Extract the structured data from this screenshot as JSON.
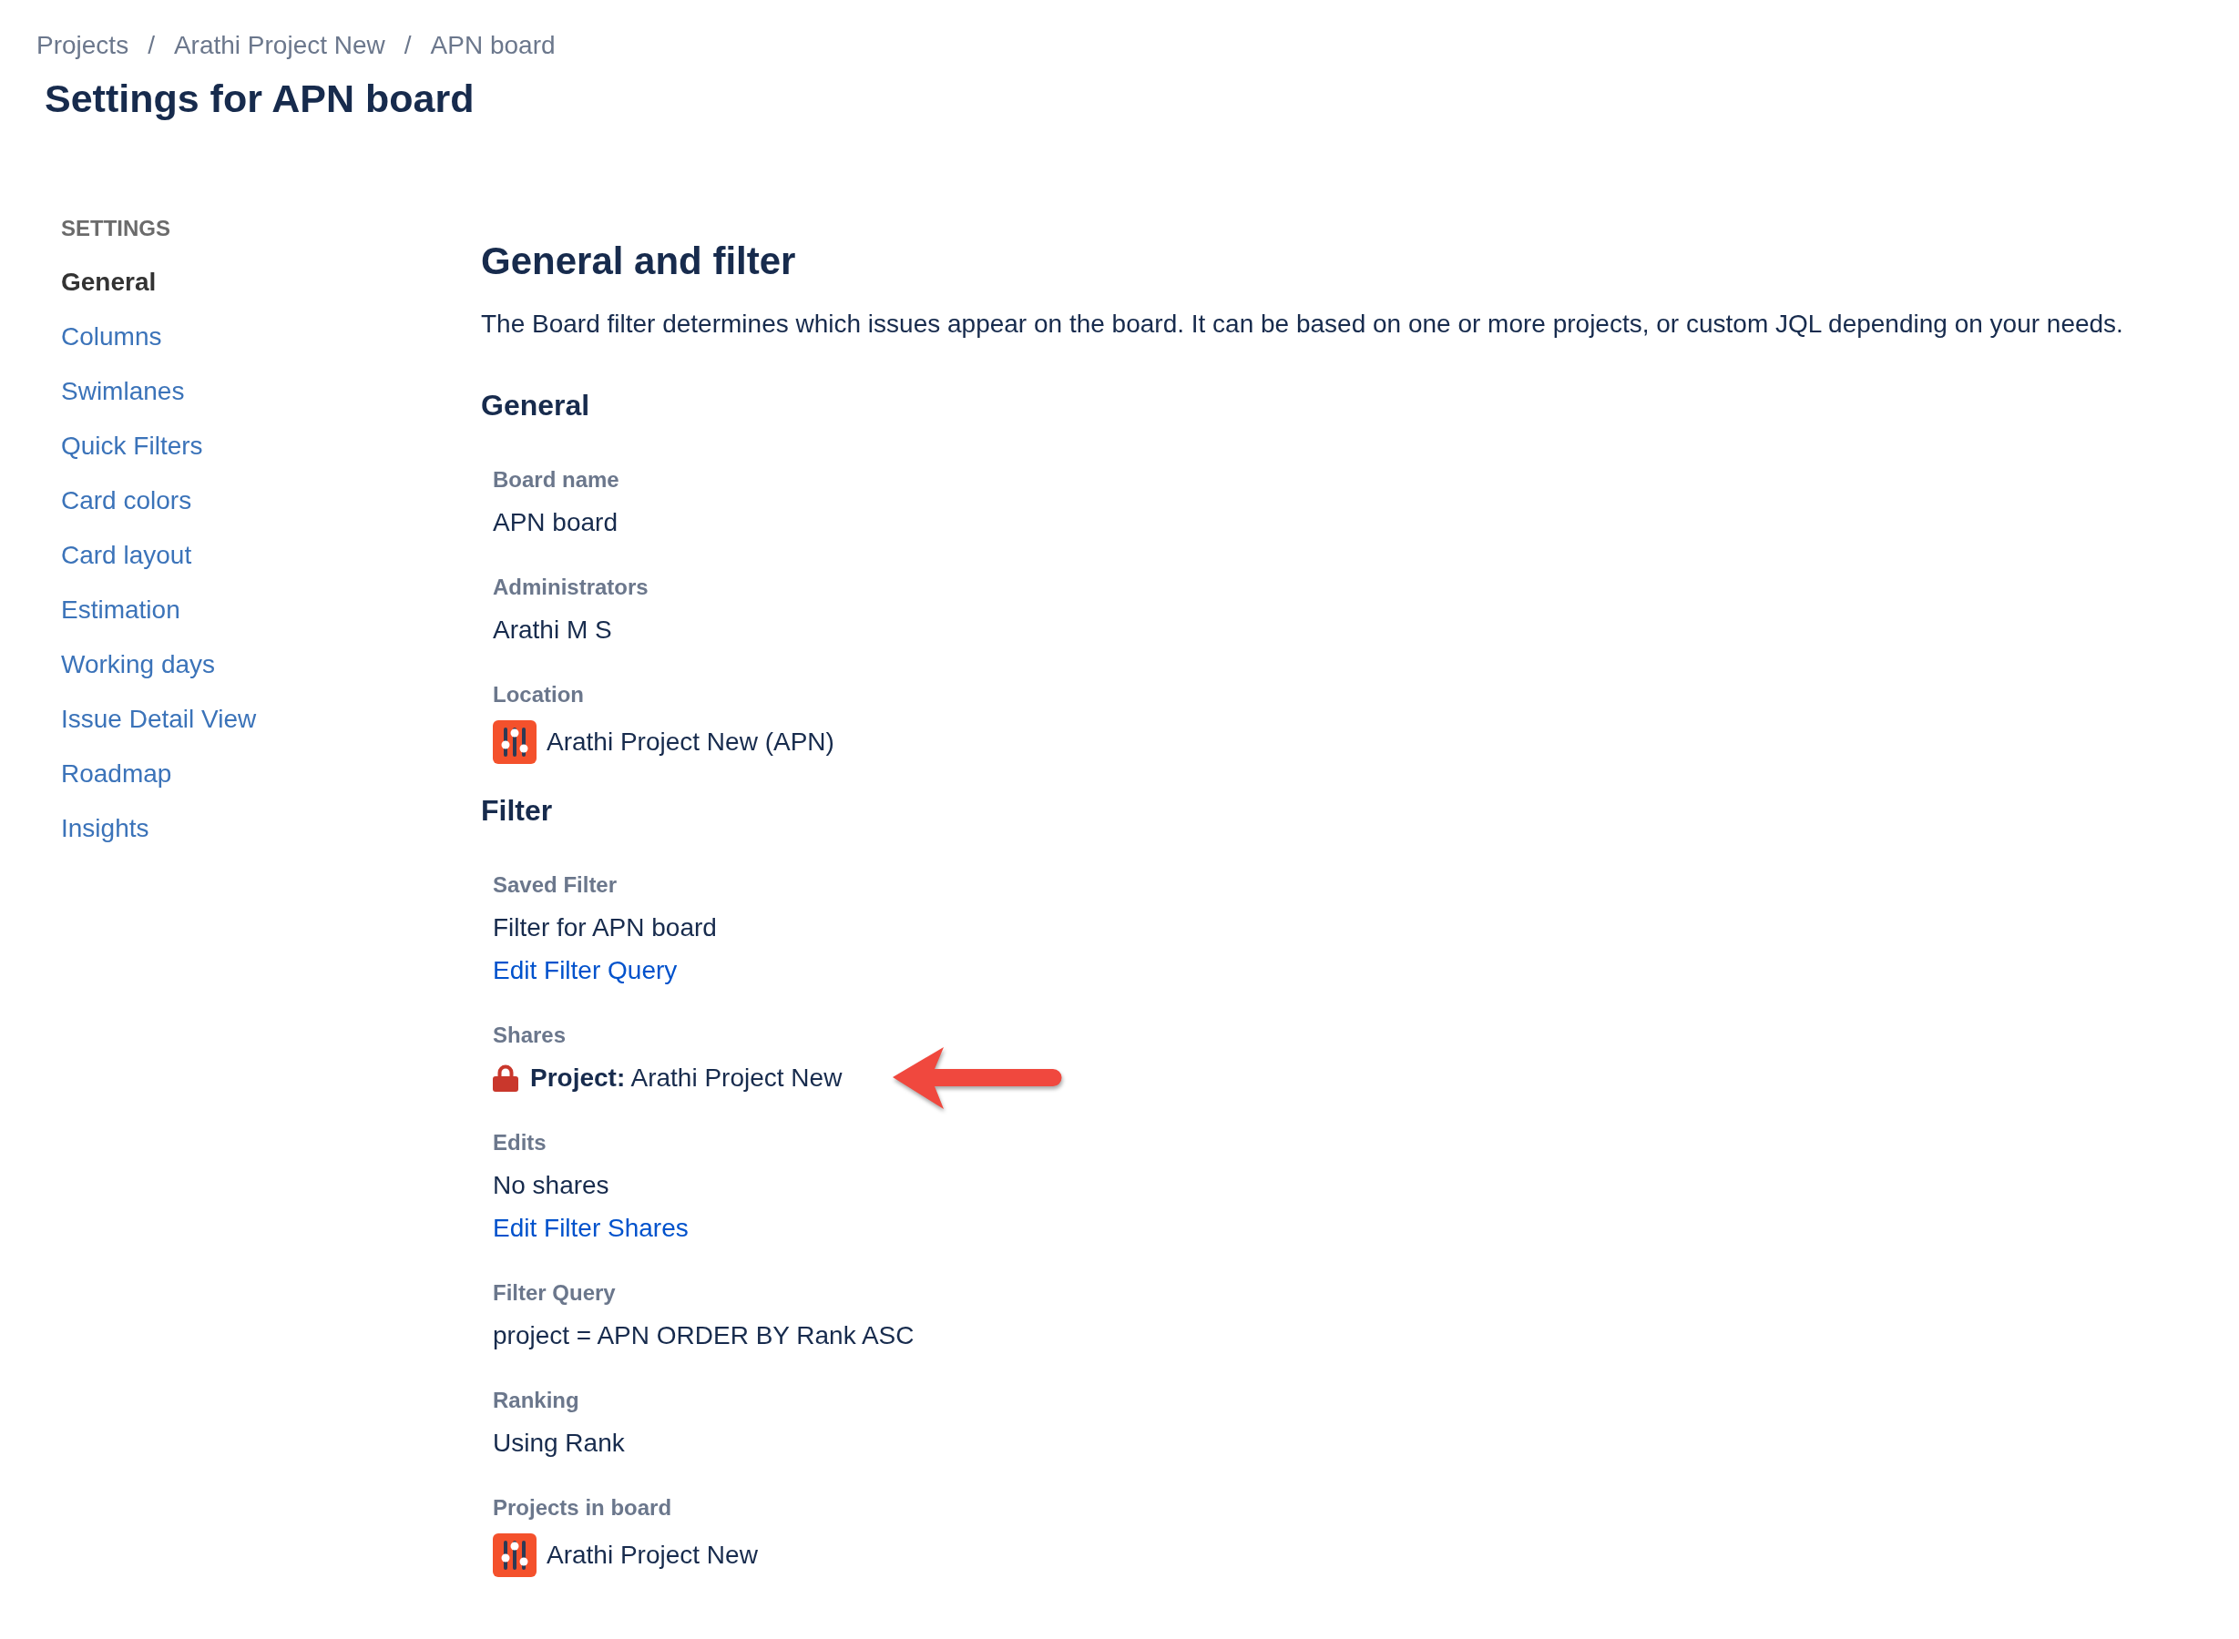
{
  "breadcrumbs": [
    {
      "label": "Projects",
      "separator": "/"
    },
    {
      "label": "Arathi Project New",
      "separator": "/"
    },
    {
      "label": "APN board"
    }
  ],
  "page_title": "Settings for APN board",
  "sidebar": {
    "heading": "SETTINGS",
    "items": [
      {
        "label": "General",
        "selected": true
      },
      {
        "label": "Columns",
        "selected": false
      },
      {
        "label": "Swimlanes",
        "selected": false
      },
      {
        "label": "Quick Filters",
        "selected": false
      },
      {
        "label": "Card colors",
        "selected": false
      },
      {
        "label": "Card layout",
        "selected": false
      },
      {
        "label": "Estimation",
        "selected": false
      },
      {
        "label": "Working days",
        "selected": false
      },
      {
        "label": "Issue Detail View",
        "selected": false
      },
      {
        "label": "Roadmap",
        "selected": false
      },
      {
        "label": "Insights",
        "selected": false
      }
    ]
  },
  "main": {
    "title": "General and filter",
    "description": "The Board filter determines which issues appear on the board. It can be based on one or more projects, or custom JQL depending on your needs.",
    "sections": [
      {
        "heading": "General",
        "fields": [
          {
            "kind": "text",
            "label": "Board name",
            "value": "APN board"
          },
          {
            "kind": "text",
            "label": "Administrators",
            "value": "Arathi M S"
          },
          {
            "kind": "project",
            "label": "Location",
            "value": "Arathi Project New (APN)"
          }
        ]
      },
      {
        "heading": "Filter",
        "fields": [
          {
            "kind": "text",
            "label": "Saved Filter",
            "value": "Filter for APN board",
            "link": "Edit Filter Query"
          },
          {
            "kind": "share",
            "label": "Shares",
            "value": "**Project:** Arathi Project New",
            "annotated": true
          },
          {
            "kind": "text",
            "label": "Edits",
            "value": "No shares",
            "link": "Edit Filter Shares"
          },
          {
            "kind": "text",
            "label": "Filter Query",
            "value": "project = APN ORDER BY Rank ASC"
          },
          {
            "kind": "text",
            "label": "Ranking",
            "value": "Using Rank"
          },
          {
            "kind": "project",
            "label": "Projects in board",
            "value": "Arathi Project New"
          }
        ]
      }
    ]
  }
}
